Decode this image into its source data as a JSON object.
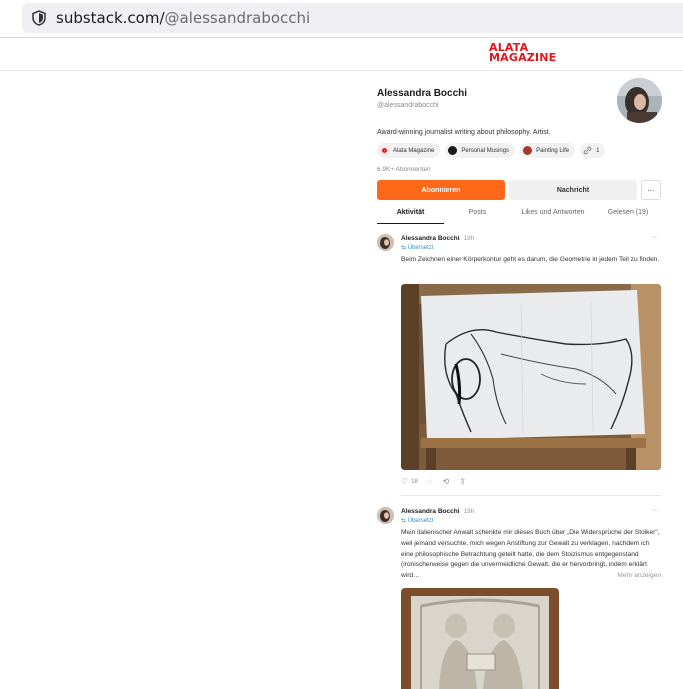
{
  "browser": {
    "url_host": "substack.com/",
    "url_path": "@alessandrabocchi"
  },
  "publication_logo": {
    "line1": "ALATA",
    "line2": "MAGAZINE",
    "color": "#e5151b"
  },
  "profile": {
    "name": "Alessandra Bocchi",
    "handle": "@alessandrabocchi",
    "bio": "Award-winning journalist writing about philosophy. Artist.",
    "publications": [
      {
        "label": "Alata Magazine",
        "icon": "alata-logo-icon"
      },
      {
        "label": "Personal Musings",
        "icon": "personal-musings-icon"
      },
      {
        "label": "Painting Life",
        "icon": "painting-life-icon"
      },
      {
        "label": "1",
        "icon": "link-icon"
      }
    ],
    "subscribers": "6.9K+ Abonnenten",
    "subscribe_label": "Abonnieren",
    "message_label": "Nachricht",
    "more_label": "···",
    "accent_color": "#ff6719"
  },
  "tabs": [
    {
      "label": "Aktivität",
      "active": true
    },
    {
      "label": "Posts",
      "active": false
    },
    {
      "label": "Likes und Antworten",
      "active": false
    },
    {
      "label": "Gelesen (19)",
      "active": false
    }
  ],
  "posts": [
    {
      "author": "Alessandra Bocchi",
      "time": "18h",
      "translated": "Übersetzt",
      "text": "Beim Zeichnen einer Körperkontur geht es darum, die Geometrie in jedem Teil zu finden.",
      "likes": "18",
      "image": "figure-drawing-on-easel"
    },
    {
      "author": "Alessandra Bocchi",
      "time": "19h",
      "translated": "Übersetzt",
      "text": "Mein italienischer Anwalt schenkte mir dieses Buch über „Die Widersprüche der Stoiker\", weil jemand versuchte, mich wegen Anstiftung zur Gewalt zu verklagen, nachdem ich eine philosophische Betrachtung geteilt hatte, die dem Stoizismus entgegenstand (ironischerweise gegen die unvermeidliche Gewalt, die er hervorbringt, indem erklärt wird…",
      "more_label": "Mehr anzeigen",
      "image": "marble-relief-book-cover"
    }
  ]
}
